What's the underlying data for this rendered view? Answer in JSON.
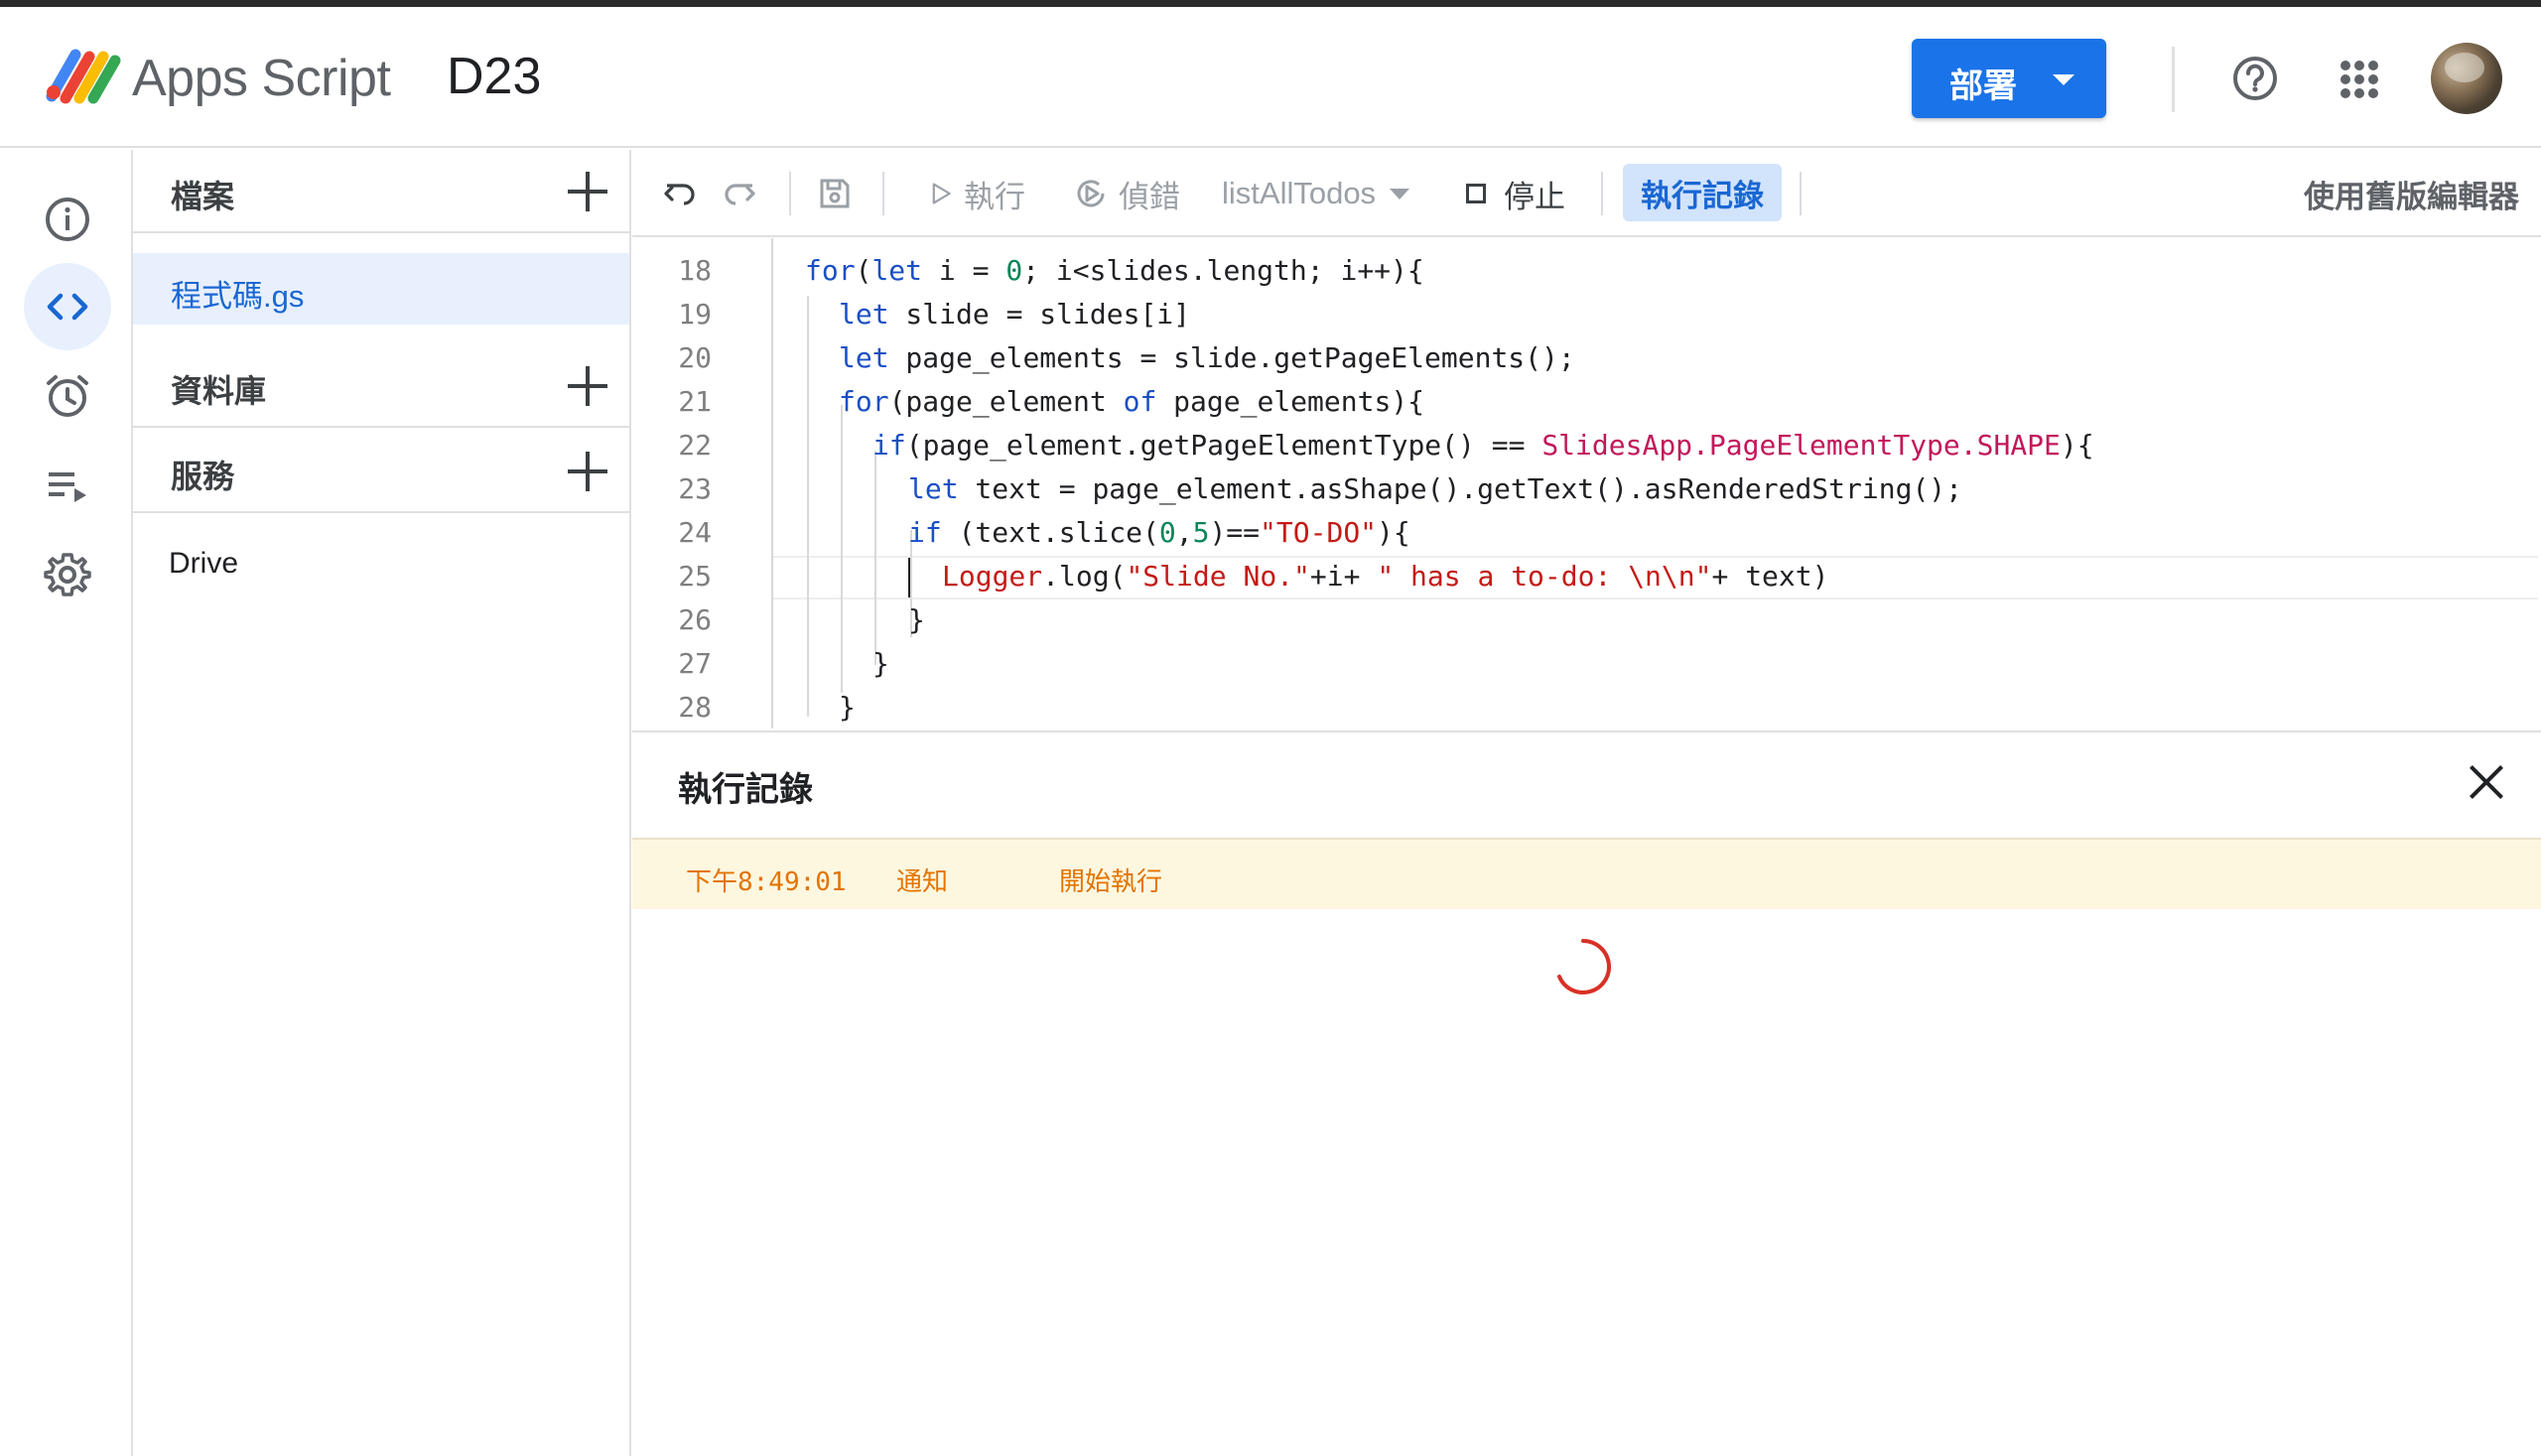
{
  "header": {
    "app_name": "Apps Script",
    "project_name": "D23",
    "deploy_label": "部署",
    "brand_color": "#1a73e8"
  },
  "rail": {
    "items": [
      {
        "icon": "info-icon"
      },
      {
        "icon": "code-icon",
        "active": true
      },
      {
        "icon": "alarm-clock-icon"
      },
      {
        "icon": "executions-icon"
      },
      {
        "icon": "gear-icon"
      }
    ]
  },
  "files_panel": {
    "files_label": "檔案",
    "files": [
      "程式碼.gs"
    ],
    "libraries_label": "資料庫",
    "services_label": "服務",
    "services": [
      "Drive"
    ]
  },
  "toolbar": {
    "run_label": "執行",
    "debug_label": "偵錯",
    "function_name": "listAllTodos",
    "stop_label": "停止",
    "execution_log_label": "執行記錄",
    "legacy_editor_label": "使用舊版編輯器"
  },
  "editor": {
    "line_numbers": [
      "18",
      "19",
      "20",
      "21",
      "22",
      "23",
      "24",
      "25",
      "26",
      "27",
      "28"
    ],
    "current_line": "25"
  },
  "execution_log": {
    "title": "執行記錄",
    "entries": [
      {
        "time": "下午8:49:01",
        "level": "通知",
        "message": "開始執行"
      }
    ],
    "status": "loading"
  },
  "colors": {
    "keyword": "#1a4fc4",
    "string": "#c41a16",
    "number": "#098658",
    "class": "#c2185b",
    "log_warning_bg": "#fef7e0",
    "log_warning_text": "#e37400"
  }
}
